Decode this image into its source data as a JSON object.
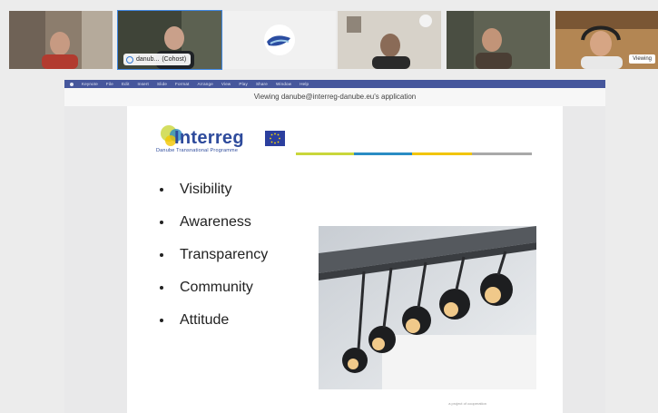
{
  "participants": [
    {
      "id": "p1",
      "name": ""
    },
    {
      "id": "p2",
      "name": "danub...",
      "org": "(Cohost)",
      "active": true
    },
    {
      "id": "p3",
      "name": ""
    },
    {
      "id": "p4",
      "name": ""
    },
    {
      "id": "p5",
      "name": "",
      "tag": "Viewing"
    }
  ],
  "share": {
    "viewing_label": "Viewing danube@interreg-danube.eu's application",
    "menubar": [
      "Keynote",
      "File",
      "Edit",
      "Insert",
      "Slide",
      "Format",
      "Arrange",
      "View",
      "Play",
      "Share",
      "Window",
      "Help"
    ]
  },
  "slide": {
    "brand": "Interreg",
    "brand_sub": "Danube Transnational Programme",
    "bullets": [
      "Visibility",
      "Awareness",
      "Transparency",
      "Community",
      "Attitude"
    ],
    "footnote": "a project of cooperation",
    "rule_colors": [
      "#c9d63a",
      "#2a8cc4",
      "#f2c500",
      "#a9a9a9"
    ]
  },
  "colors": {
    "accent": "#3f86e0",
    "menubar": "#46579c",
    "brand": "#2e4b9c"
  }
}
